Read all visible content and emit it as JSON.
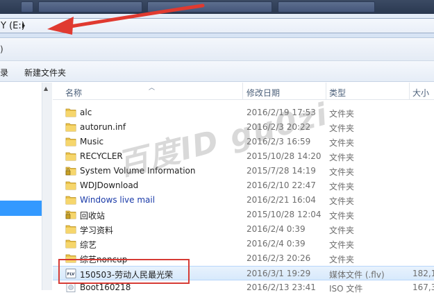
{
  "address": {
    "path": "Y (E:)"
  },
  "subbar": {
    "text": ")"
  },
  "toolbar": {
    "left_label": "录",
    "new_folder": "新建文件夹"
  },
  "columns": {
    "name": "名称",
    "date": "修改日期",
    "type": "类型",
    "size": "大小"
  },
  "files": [
    {
      "name": "alc",
      "date": "2016/2/19 17:53",
      "type": "文件夹",
      "size": "",
      "icon": "folder-icon"
    },
    {
      "name": "autorun.inf",
      "date": "2016/2/3 20:22",
      "type": "文件夹",
      "size": "",
      "icon": "folder-icon"
    },
    {
      "name": "Music",
      "date": "2016/2/3 16:59",
      "type": "文件夹",
      "size": "",
      "icon": "folder-icon"
    },
    {
      "name": "RECYCLER",
      "date": "2015/10/28 14:20",
      "type": "文件夹",
      "size": "",
      "icon": "folder-icon"
    },
    {
      "name": "System Volume Information",
      "date": "2015/7/28 14:19",
      "type": "文件夹",
      "size": "",
      "icon": "locked-folder-icon"
    },
    {
      "name": "WDJDownload",
      "date": "2016/2/10 22:47",
      "type": "文件夹",
      "size": "",
      "icon": "folder-icon"
    },
    {
      "name": "Windows live mail",
      "date": "2016/2/21 16:04",
      "type": "文件夹",
      "size": "",
      "icon": "folder-icon"
    },
    {
      "name": "回收站",
      "date": "2015/10/28 12:04",
      "type": "文件夹",
      "size": "",
      "icon": "locked-folder-icon"
    },
    {
      "name": "学习资料",
      "date": "2016/2/4 0:39",
      "type": "文件夹",
      "size": "",
      "icon": "folder-icon"
    },
    {
      "name": "综艺",
      "date": "2016/2/4 0:39",
      "type": "文件夹",
      "size": "",
      "icon": "folder-icon"
    },
    {
      "name": "综艺noncup",
      "date": "2016/2/3 20:26",
      "type": "文件夹",
      "size": "",
      "icon": "folder-icon"
    },
    {
      "name": "150503-劳动人民最光荣",
      "date": "2016/3/1 19:29",
      "type": "媒体文件 (.flv)",
      "size": "182,1",
      "icon": "flv-file-icon"
    },
    {
      "name": "Boot160218",
      "date": "2016/2/13 23:41",
      "type": "ISO 文件",
      "size": "167,3",
      "icon": "iso-file-icon"
    }
  ],
  "watermark": "百度ID  gu0zi",
  "colors": {
    "selection": "#3399ff",
    "annotation_red": "#d63b35",
    "link_blue": "#1a3aa8"
  }
}
